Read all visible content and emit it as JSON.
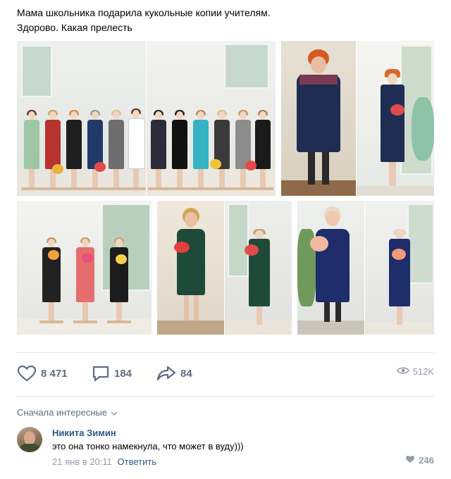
{
  "post": {
    "line1": "Мама школьника подарила кукольные копии учителям.",
    "line2": "Здорово. Какая прелесть"
  },
  "photos": [
    {
      "name": "photo-dolls-group-1"
    },
    {
      "name": "photo-dolls-group-2"
    },
    {
      "name": "photo-teacher-1"
    },
    {
      "name": "photo-doll-1"
    },
    {
      "name": "photo-dolls-trio"
    },
    {
      "name": "photo-teacher-2"
    },
    {
      "name": "photo-doll-2"
    },
    {
      "name": "photo-teacher-3"
    },
    {
      "name": "photo-doll-3"
    }
  ],
  "actions": {
    "likes": "8 471",
    "comments": "184",
    "shares": "84",
    "views": "512K",
    "like_icon": "heart-icon",
    "comment_icon": "speech-bubble-icon",
    "share_icon": "share-arrow-icon",
    "views_icon": "eye-icon"
  },
  "comments_sort": {
    "label": "Сначала интересные",
    "icon": "chevron-down-icon"
  },
  "comment": {
    "author": "Никита Зимин",
    "text": "это она тонко намекнула, что может в вуду)))",
    "date": "21 янв в 20:11",
    "reply_label": "Ответить",
    "likes": "246"
  },
  "colors": {
    "link": "#2a5885",
    "icon": "#5d6d82",
    "muted": "#939cab"
  }
}
